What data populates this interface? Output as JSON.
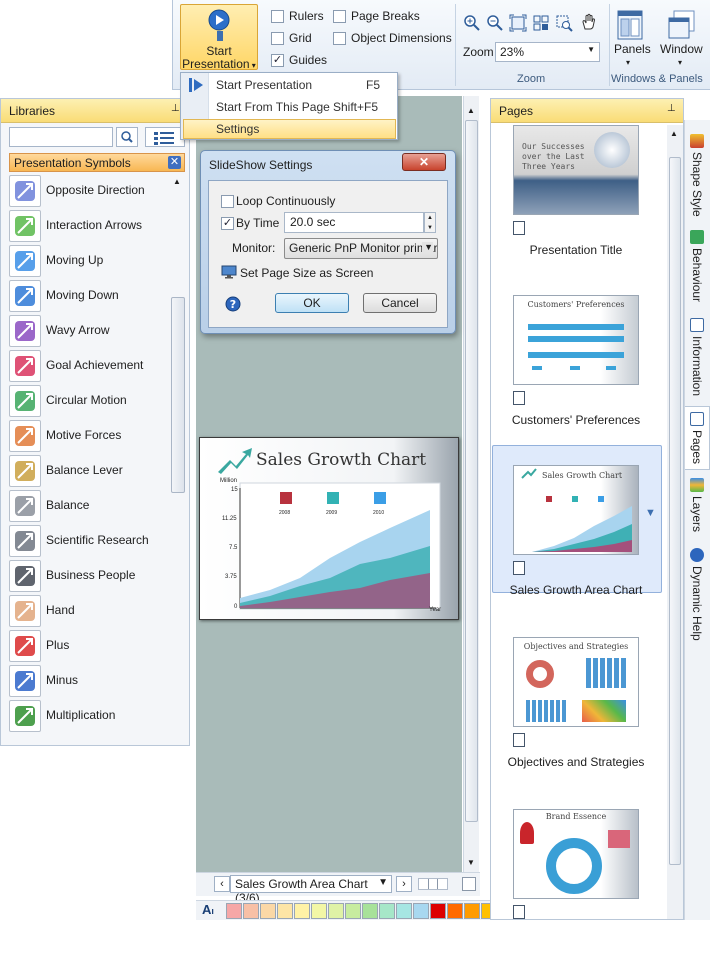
{
  "ribbon": {
    "start_presentation": "Start\nPresentation",
    "checks": [
      {
        "label": "Rulers",
        "checked": false
      },
      {
        "label": "Grid",
        "checked": false
      },
      {
        "label": "Guides",
        "checked": true
      },
      {
        "label": "Page Breaks",
        "checked": false
      },
      {
        "label": "Object Dimensions",
        "checked": false
      }
    ],
    "zoom_label": "Zoom",
    "zoom_value": "23%",
    "zoom_group": "Zoom",
    "panels": "Panels",
    "window": "Window",
    "windows_group": "Windows & Panels"
  },
  "menu": {
    "items": [
      {
        "label": "Start Presentation",
        "shortcut": "F5"
      },
      {
        "label": "Start From This Page",
        "shortcut": "Shift+F5"
      },
      {
        "label": "Settings",
        "shortcut": ""
      }
    ]
  },
  "libraries": {
    "title": "Libraries",
    "category": "Presentation Symbols",
    "items": [
      {
        "label": "Opposite Direction",
        "icon": "opposite-direction-icon",
        "color": "#6b7fd8"
      },
      {
        "label": "Interaction Arrows",
        "icon": "interaction-arrows-icon",
        "color": "#58b84a"
      },
      {
        "label": "Moving Up",
        "icon": "moving-up-icon",
        "color": "#3a8ee6"
      },
      {
        "label": "Moving Down",
        "icon": "moving-down-icon",
        "color": "#2f79d6"
      },
      {
        "label": "Wavy Arrow",
        "icon": "wavy-arrow-icon",
        "color": "#8a4cc0"
      },
      {
        "label": "Goal Achievement",
        "icon": "goal-achievement-icon",
        "color": "#d9345e"
      },
      {
        "label": "Circular Motion",
        "icon": "circular-motion-icon",
        "color": "#3aa65a"
      },
      {
        "label": "Motive Forces",
        "icon": "motive-forces-icon",
        "color": "#e07a3a"
      },
      {
        "label": "Balance Lever",
        "icon": "balance-lever-icon",
        "color": "#c9a040"
      },
      {
        "label": "Balance",
        "icon": "balance-icon",
        "color": "#8a8f99"
      },
      {
        "label": "Scientific Research",
        "icon": "scientific-research-icon",
        "color": "#6d7480"
      },
      {
        "label": "Business People",
        "icon": "business-people-icon",
        "color": "#444a55"
      },
      {
        "label": "Hand",
        "icon": "hand-icon",
        "color": "#e0a67a"
      },
      {
        "label": "Plus",
        "icon": "plus-icon",
        "color": "#d92b2b"
      },
      {
        "label": "Minus",
        "icon": "minus-icon",
        "color": "#2b63c8"
      },
      {
        "label": "Multiplication",
        "icon": "multiplication-icon",
        "color": "#2f8f2f"
      }
    ]
  },
  "dialog": {
    "title": "SlideShow Settings",
    "loop": "Loop Continuously",
    "by_time": "By Time",
    "by_time_checked": true,
    "time_value": "20.0 sec",
    "monitor_label": "Monitor:",
    "monitor_value": "Generic PnP Monitor primar",
    "page_size": "Set Page Size as Screen",
    "ok": "OK",
    "cancel": "Cancel"
  },
  "slide": {
    "title": "Sales Growth Chart",
    "ylabel": "Million",
    "xlabel": "Year",
    "yticks": [
      "15",
      "11.25",
      "7.5",
      "3.75",
      "0"
    ],
    "legend": [
      "2008",
      "2009",
      "2010"
    ]
  },
  "navigator": {
    "page": "Sales Growth Area Chart (3/6)"
  },
  "pages": {
    "title": "Pages",
    "items": [
      {
        "label": "Presentation Title",
        "thumb_text": "Our Successes over the Last Three Years"
      },
      {
        "label": "Customers' Preferences",
        "thumb_text": "Customers' Preferences"
      },
      {
        "label": "Sales Growth Area Chart",
        "thumb_text": "Sales Growth Chart"
      },
      {
        "label": "Objectives and Strategies",
        "thumb_text": "Objectives and Strategies"
      },
      {
        "label": "",
        "thumb_text": "Brand Essence"
      }
    ]
  },
  "sidetabs": [
    "Shape Style",
    "Behaviour",
    "Information",
    "Pages",
    "Layers",
    "Dynamic Help"
  ],
  "colors": [
    "#f6a7a7",
    "#f8c0a6",
    "#fbd8a6",
    "#fde5a6",
    "#fff2a6",
    "#f3f7a6",
    "#dff2a6",
    "#c7ec9f",
    "#a8e29a",
    "#a6e7c8",
    "#a6e6e3",
    "#a8d8f0",
    "#dd0000",
    "#ff6a00",
    "#ff9b00",
    "#ffc000"
  ]
}
